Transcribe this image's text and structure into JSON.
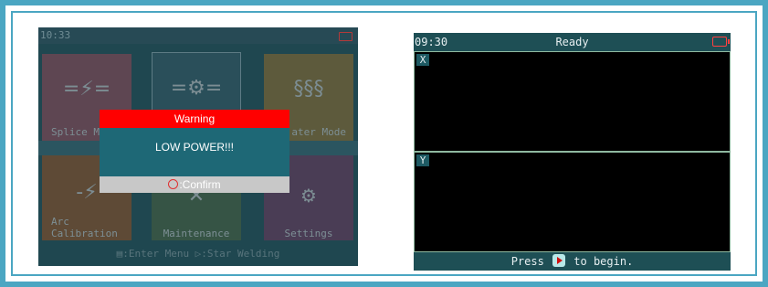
{
  "left_screen": {
    "time": "10:33",
    "tiles": {
      "splice": {
        "label": "Splice M",
        "icon": "=⚡="
      },
      "center": {
        "icon": "=⚙="
      },
      "heater": {
        "label": "ater Mode",
        "icon": "§§§"
      },
      "arc": {
        "label_line1": "Arc",
        "label_line2": "Calibration",
        "icon": "-⚡"
      },
      "maintenance": {
        "label": "Maintenance",
        "icon": "✕"
      },
      "settings": {
        "label": "Settings",
        "icon": "⚙"
      }
    },
    "bottom_hint": "▤:Enter Menu    ▷:Star Welding",
    "dialog": {
      "title": "Warning",
      "message": "LOW POWER!!!",
      "button_label": ":Confirm"
    }
  },
  "right_screen": {
    "time": "09:30",
    "status": "Ready",
    "x_label": "X",
    "y_label": "Y",
    "footer_prefix": "Press",
    "footer_suffix": "to begin."
  }
}
